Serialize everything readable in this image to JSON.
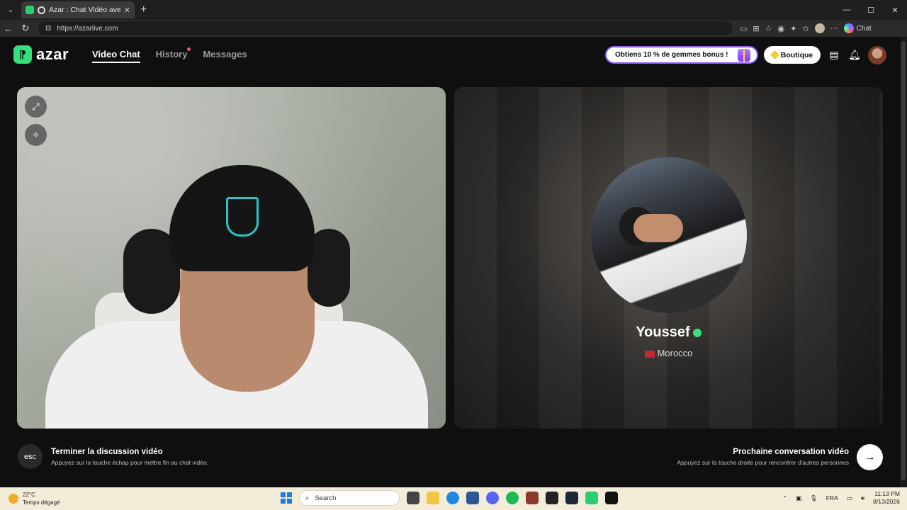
{
  "browser": {
    "tab_title": "Azar : Chat Vidéo avec de nou",
    "tab_close": "✕",
    "new_tab": "+",
    "url": "https://azarlive.com",
    "copilot_label": "Chat",
    "window_controls": [
      "—",
      "☐",
      "✕"
    ]
  },
  "header": {
    "brand": "azar",
    "nav": [
      {
        "label": "Video Chat",
        "active": true
      },
      {
        "label": "History",
        "badge": true
      },
      {
        "label": "Messages"
      }
    ],
    "promo": "Obtiens 10 % de gemmes bonus !",
    "shop": "Boutique"
  },
  "left_video": {
    "controls": [
      "expand-icon",
      "magic-wand-icon"
    ]
  },
  "right_video": {
    "name": "Youssef",
    "country": "Morocco"
  },
  "footer": {
    "esc_key": "esc",
    "end_title": "Terminer la discussion vidéo",
    "end_sub": "Appuyez sur la touche échap pour mettre fin au chat vidéo.",
    "next_title": "Prochaine conversation vidéo",
    "next_sub": "Appuyez sur la touche droite pour rencontrer d'autres personnes",
    "next_arrow": "→"
  },
  "taskbar": {
    "weather_temp": "22°C",
    "weather_desc": "Temps dégagé",
    "search_placeholder": "Search",
    "language": "FRA",
    "time": "11:13 PM",
    "date": "8/13/2026"
  },
  "colors": {
    "accent": "#34e07a",
    "promo_border": "#8a5cff",
    "history_badge": "#ff4b6e"
  }
}
